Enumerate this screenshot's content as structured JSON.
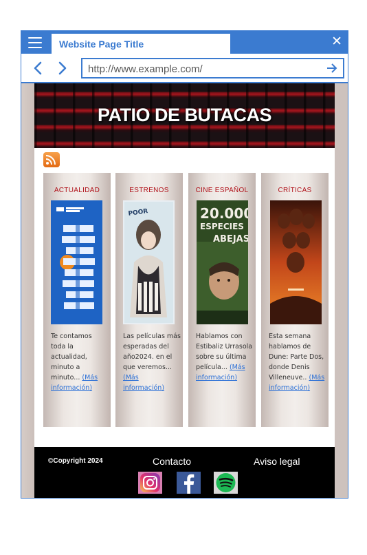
{
  "browser": {
    "menu_icon": "hamburger-menu-icon",
    "tab_title": "Website Page Title",
    "close_icon": "close-icon",
    "close_symbol": "✕",
    "back_icon": "chevron-left-icon",
    "forward_icon": "chevron-right-icon",
    "url": "http://www.example.com/",
    "go_icon": "arrow-right-icon",
    "accent_color": "#3b7bd0"
  },
  "site": {
    "banner_title": "PATIO DE BUTACAS",
    "rss_icon": "rss-feed-icon",
    "cards": [
      {
        "category": "ACTUALIDAD",
        "text": "Te contamos toda la actualidad, minuto a minuto...",
        "more": "(Más información)"
      },
      {
        "category": "ESTRENOS",
        "text": "Las películas más esperadas del año2024. en el que veremos...",
        "more": "(Más información)"
      },
      {
        "category": "CINE ESPAÑOL",
        "text": "Hablamos con Estibaliz Urrasola sobre su última película...",
        "more": "(Más información)",
        "poster_title_line1": "20.000",
        "poster_title_line2": "ESPECIES",
        "poster_title_line3": "ABEJAS"
      },
      {
        "category": "CRÍTICAS",
        "text": "Esta semana hablamos de Dune: Parte Dos, donde Denis Villeneuve..",
        "more": "(Más información)"
      }
    ],
    "footer": {
      "copyright": "©Copyright 2024",
      "contact": "Contacto",
      "legal": "Aviso legal",
      "social_icons": [
        "instagram-icon",
        "facebook-icon",
        "spotify-icon"
      ]
    },
    "category_color": "#b0121a",
    "link_color": "#2a6fd6"
  }
}
